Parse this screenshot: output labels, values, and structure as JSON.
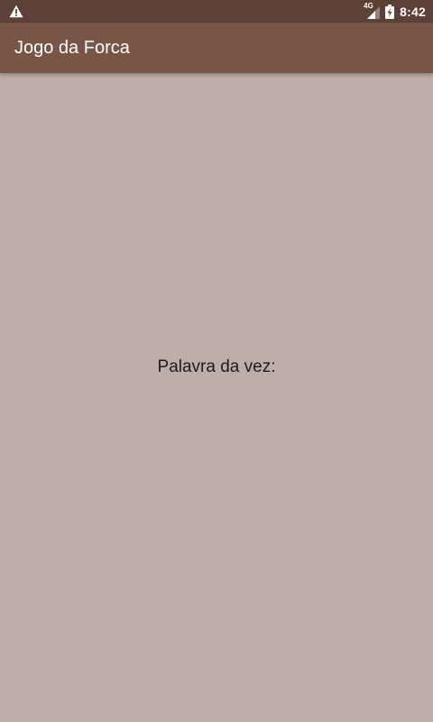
{
  "status_bar": {
    "network": "4G",
    "time": "8:42",
    "icons": [
      "warning-icon",
      "signal-icon",
      "battery-charging-icon"
    ]
  },
  "app_bar": {
    "title": "Jogo da Forca"
  },
  "main": {
    "word_label": "Palavra da vez:"
  },
  "colors": {
    "status_bar": "#5d4037",
    "app_bar": "#795548",
    "background": "#bdaea7",
    "text_dark": "#1c1c1c"
  }
}
